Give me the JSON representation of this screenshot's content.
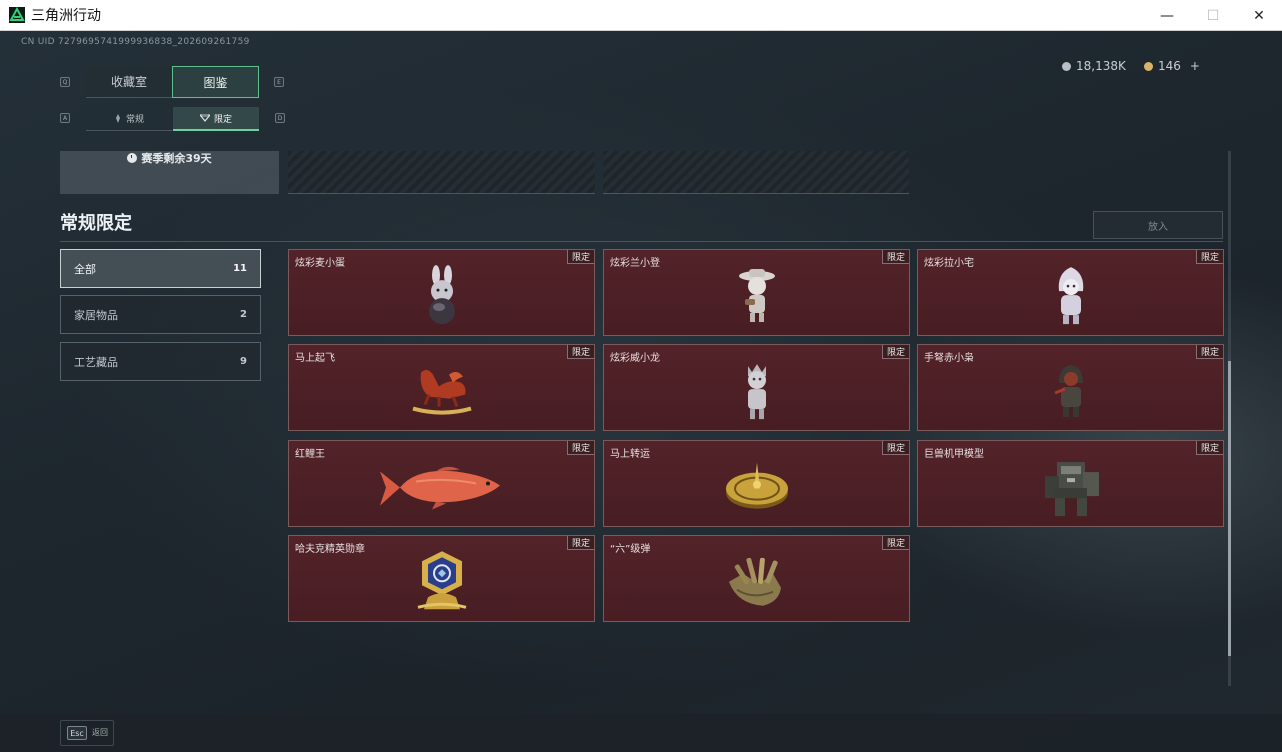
{
  "window": {
    "title": "三角洲行动",
    "minimize": "—",
    "maximize": "☐",
    "close": "✕"
  },
  "header": {
    "uid": "CN UID 7279695741999936838_202609261759",
    "currency_silver": "18,138K",
    "currency_gold": "146",
    "add_label": "+"
  },
  "tabs": {
    "key_left": "Q",
    "key_right": "E",
    "items": [
      {
        "label": "收藏室",
        "active": false
      },
      {
        "label": "图鉴",
        "active": true
      }
    ]
  },
  "subtabs": {
    "key_left": "A",
    "key_right": "D",
    "items": [
      {
        "label": "常规",
        "active": false
      },
      {
        "label": "限定",
        "active": true
      }
    ]
  },
  "season": {
    "text": "赛季剩余39天"
  },
  "section": {
    "title": "常规限定",
    "put_button": "放入"
  },
  "filters": [
    {
      "label": "全部",
      "count": "11",
      "active": true
    },
    {
      "label": "家居物品",
      "count": "2",
      "active": false
    },
    {
      "label": "工艺藏品",
      "count": "9",
      "active": false
    }
  ],
  "items": [
    {
      "name": "炫彩麦小蛋",
      "tag": "限定",
      "icon": "bunny-egg-figure-icon"
    },
    {
      "name": "炫彩兰小登",
      "tag": "限定",
      "icon": "sombrero-doll-icon"
    },
    {
      "name": "炫彩拉小宅",
      "tag": "限定",
      "icon": "hooded-doll-icon"
    },
    {
      "name": "马上起飞",
      "tag": "限定",
      "icon": "red-rocking-horse-icon"
    },
    {
      "name": "炫彩威小龙",
      "tag": "限定",
      "icon": "silver-dragon-doll-icon"
    },
    {
      "name": "手弩赤小枭",
      "tag": "限定",
      "icon": "red-hooded-figure-icon"
    },
    {
      "name": "红鲤王",
      "tag": "限定",
      "icon": "red-carp-fish-icon"
    },
    {
      "name": "马上转运",
      "tag": "限定",
      "icon": "golden-spinning-top-icon"
    },
    {
      "name": "巨兽机甲模型",
      "tag": "限定",
      "icon": "mech-model-icon"
    },
    {
      "name": "哈夫克精英勋章",
      "tag": "限定",
      "icon": "elite-medal-icon"
    },
    {
      "name": "“六”级弹",
      "tag": "限定",
      "icon": "bullet-claw-icon"
    }
  ],
  "footer": {
    "esc_key": "Esc",
    "esc_label": "返回"
  },
  "colors": {
    "accent_green": "#5fbf8d",
    "card_red": "#4b2025",
    "background": "#1b2228"
  }
}
